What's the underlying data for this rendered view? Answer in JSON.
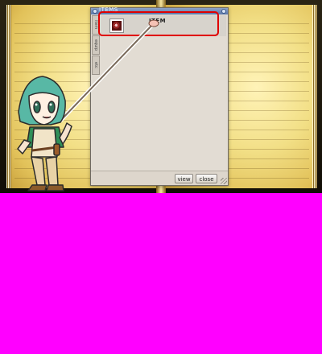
{
  "window": {
    "title": "ITEMS",
    "side_tabs": [
      "item",
      "equip",
      "etc"
    ],
    "items": [
      {
        "icon": "red-item-icon",
        "name": "ITEM"
      }
    ],
    "buttons": {
      "view": "view",
      "close": "close"
    }
  },
  "colors": {
    "highlight": "#e00000",
    "window_bg": "#e2dcd3",
    "selected_row": "#d7d3cc",
    "background_magenta": "#ff00ff"
  }
}
